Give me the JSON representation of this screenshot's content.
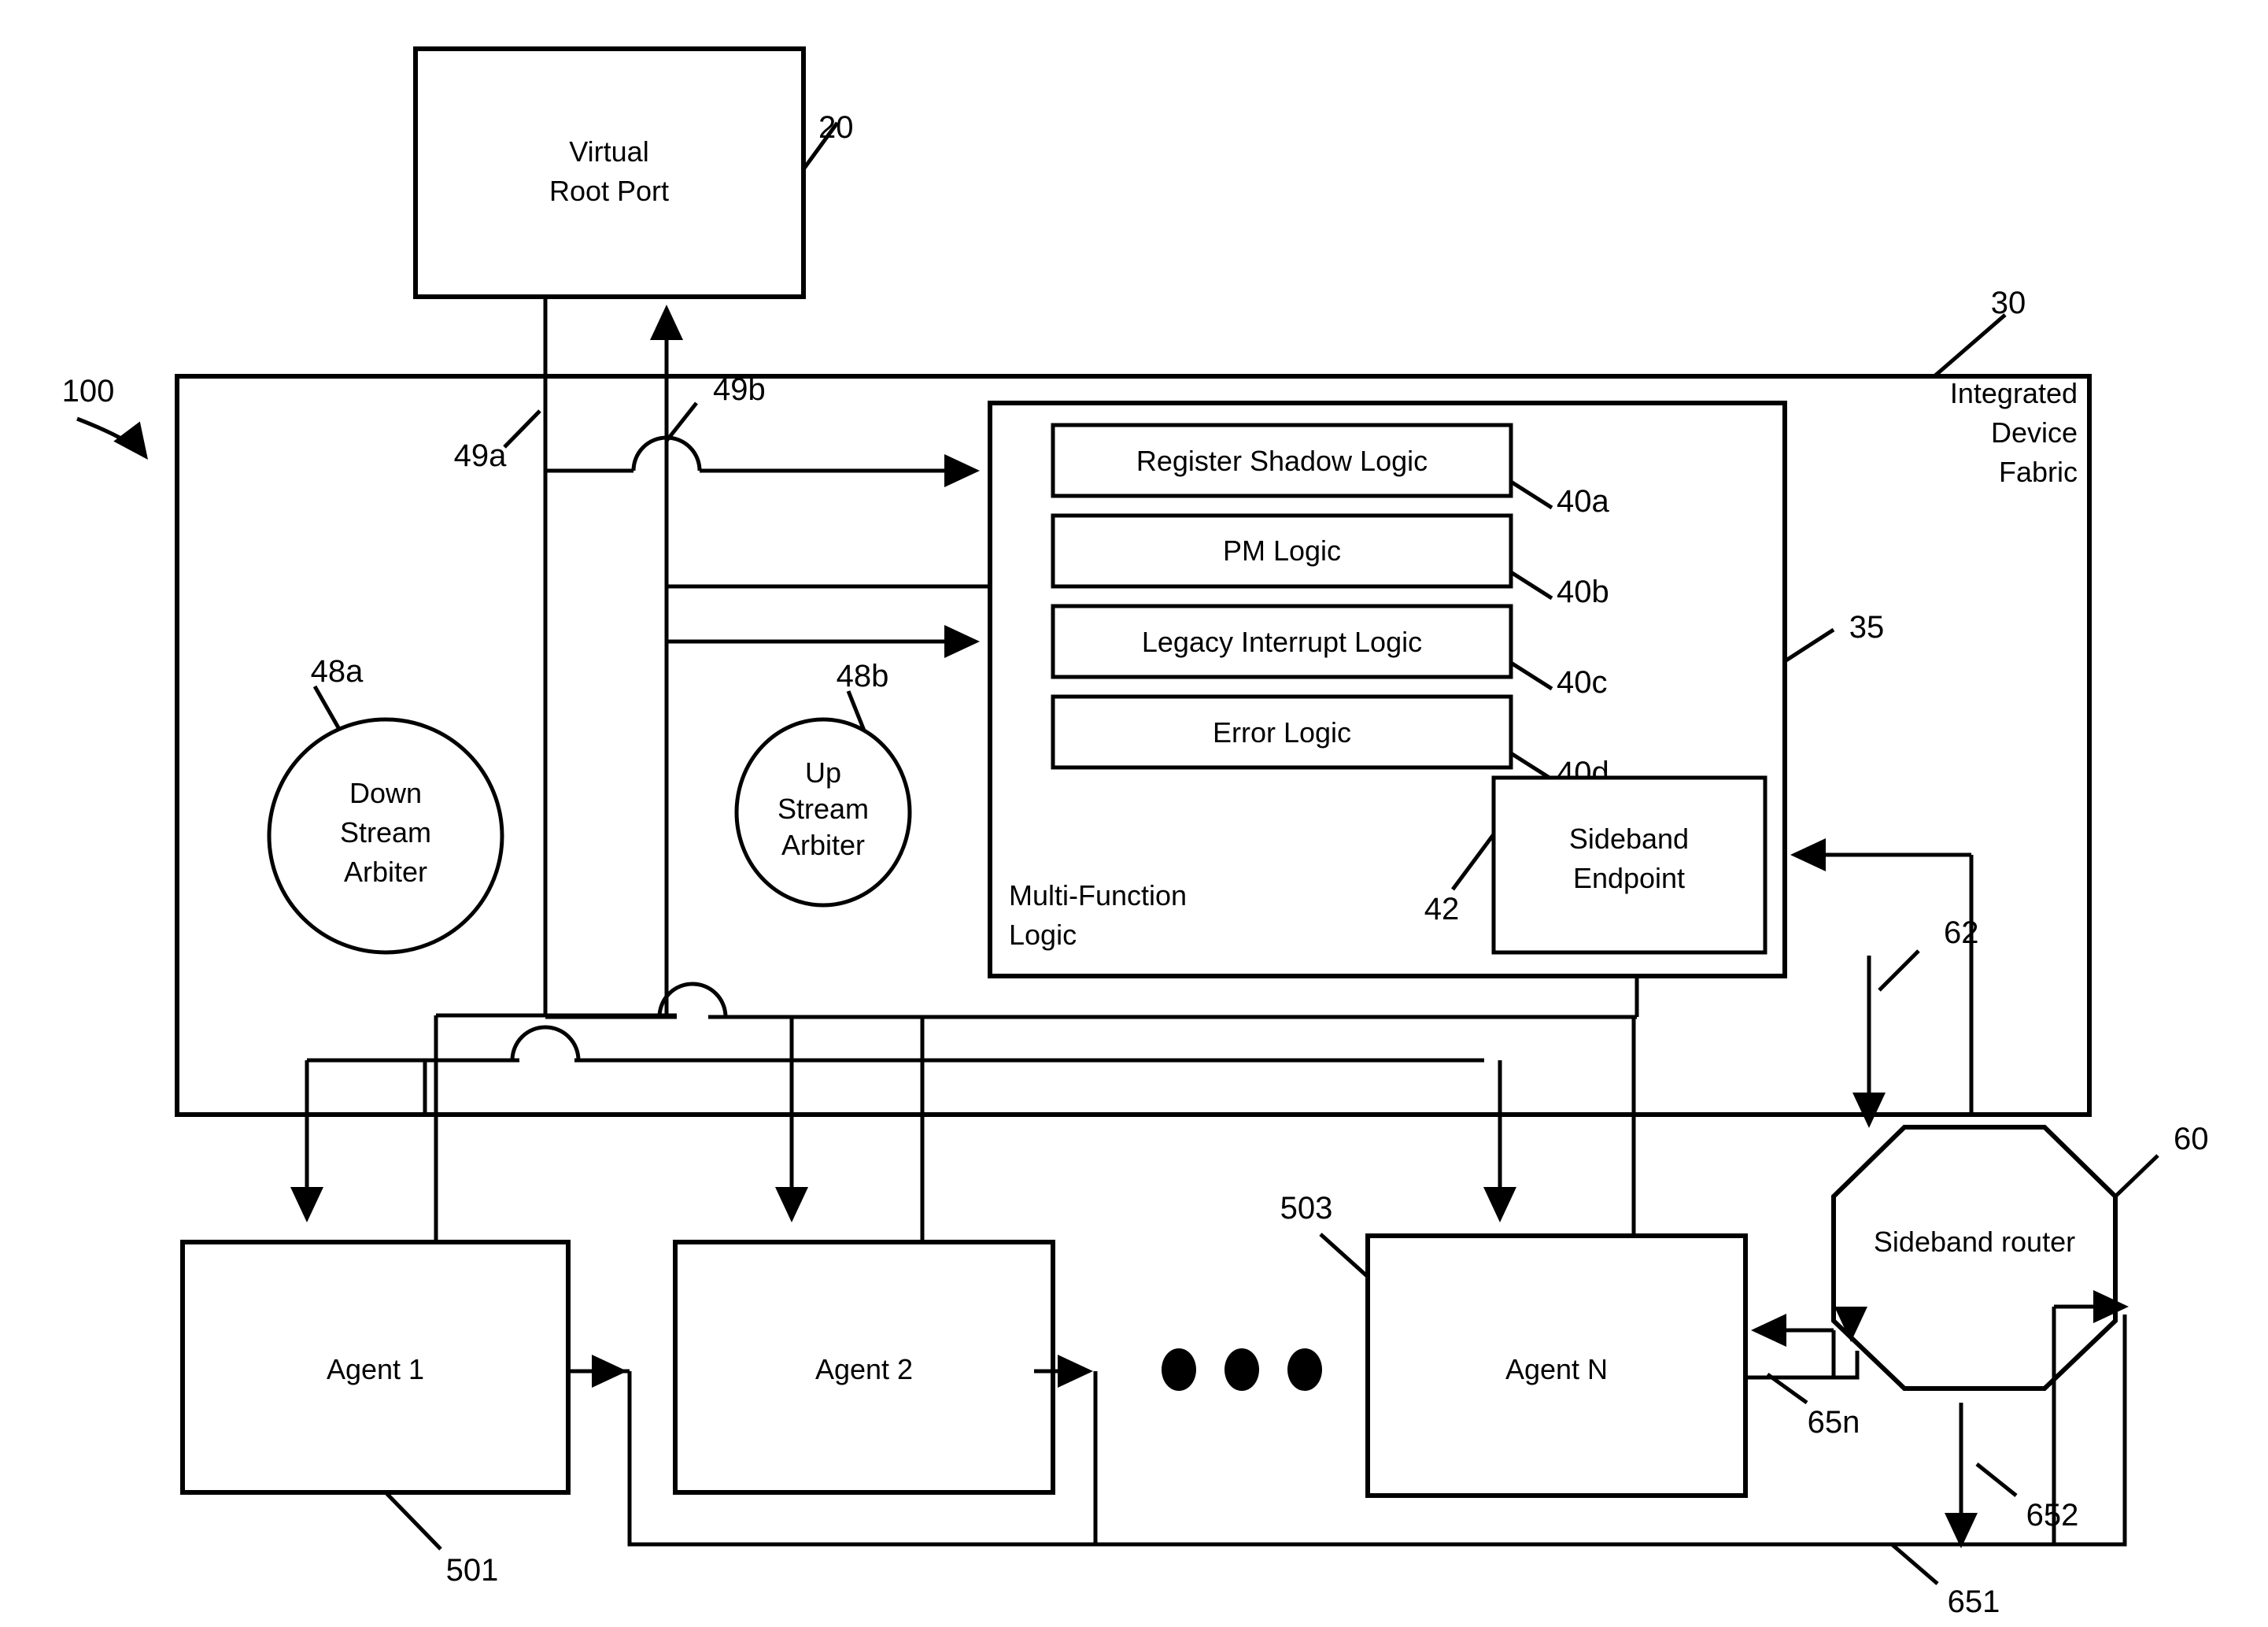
{
  "figure": {
    "top_box": {
      "line1": "Virtual",
      "line2": "Root Port",
      "ref": "20"
    },
    "system_ref": "100",
    "fabric": {
      "ref": "30",
      "label_line1": "Integrated",
      "label_line2": "Device",
      "label_line3": "Fabric"
    },
    "multi_function_logic": {
      "ref": "35",
      "label_line1": "Multi-Function",
      "label_line2": "Logic",
      "blocks": [
        {
          "label": "Register Shadow Logic",
          "ref": "40a"
        },
        {
          "label": "PM Logic",
          "ref": "40b"
        },
        {
          "label": "Legacy Interrupt Logic",
          "ref": "40c"
        },
        {
          "label": "Error Logic",
          "ref": "40d"
        }
      ],
      "sideband_endpoint": {
        "line1": "Sideband",
        "line2": "Endpoint",
        "ref": "42"
      }
    },
    "arbiters": [
      {
        "line1": "Down",
        "line2": "Stream",
        "line3": "Arbiter",
        "ref": "48a"
      },
      {
        "line1": "Up",
        "line2": "Stream",
        "line3": "Arbiter",
        "ref": "48b"
      }
    ],
    "links": {
      "downstream_ref": "49a",
      "upstream_ref": "49b",
      "sideband_link_ref": "62",
      "agent_sideband_n_ref": "65n",
      "agent_sideband_2_ref": "652",
      "agent_sideband_1_ref": "651"
    },
    "agents": [
      {
        "label": "Agent 1",
        "ref": "501"
      },
      {
        "label": "Agent 2",
        "ref": ""
      },
      {
        "label": "Agent N",
        "ref": "503"
      }
    ],
    "ellipsis_dots": 3,
    "sideband_router": {
      "label": "Sideband router",
      "ref": "60"
    }
  },
  "colors": {
    "ink": "#000000",
    "paper": "#ffffff"
  }
}
